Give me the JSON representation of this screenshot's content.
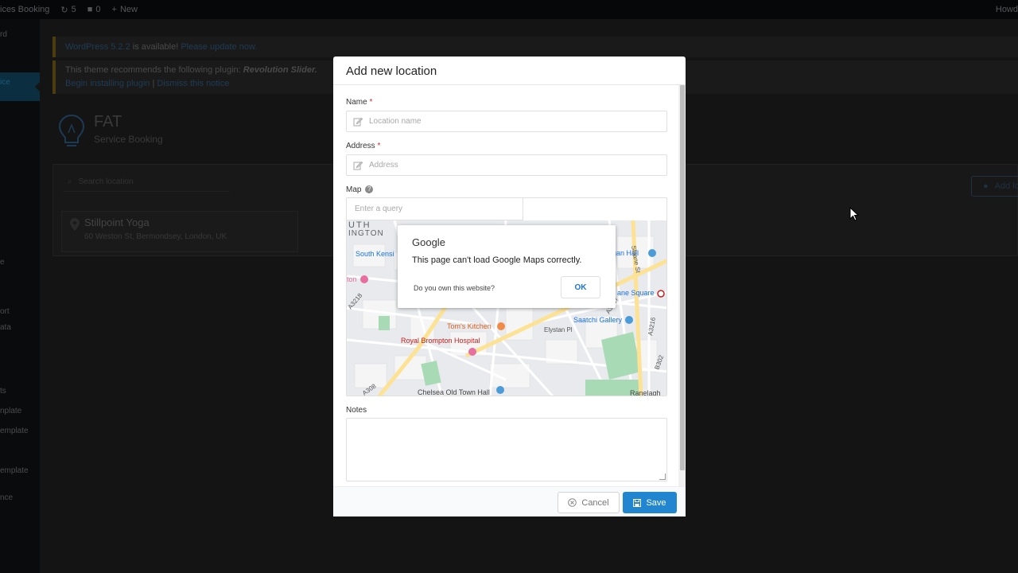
{
  "adminbar": {
    "site_name": "ices Booking",
    "updates_count": "5",
    "comments_count": "0",
    "new_label": "New",
    "howdy": "Howd"
  },
  "sidebar": {
    "items": [
      "rd",
      "ice",
      "e",
      "ort",
      "ata",
      "ts",
      "nplate",
      "emplate",
      "emplate",
      "nce"
    ]
  },
  "notices": {
    "update_text_link": "WordPress 5.2.2",
    "update_text": " is available! ",
    "update_action": "Please update now.",
    "plugin_text": "This theme recommends the following plugin: ",
    "plugin_name": "Revolution Slider.",
    "begin_install": "Begin installing plugin",
    "separator": " | ",
    "dismiss": "Dismiss this notice"
  },
  "brand": {
    "title": "FAT",
    "subtitle": "Service Booking"
  },
  "background_list": {
    "search_placeholder": "Search location",
    "location_name": "Stillpoint Yoga",
    "location_address": "60 Weston St, Bermondsey, London, UK",
    "add_button": "Add lo"
  },
  "modal": {
    "title": "Add new location",
    "name_label": "Name",
    "name_placeholder": "Location name",
    "address_label": "Address",
    "address_placeholder": "Address",
    "required_mark": "*",
    "map_label": "Map",
    "map_help": "?",
    "map_query_placeholder": "Enter a query",
    "notes_label": "Notes",
    "cancel_label": "Cancel",
    "save_label": "Save"
  },
  "map": {
    "dialog_brand": "Google",
    "dialog_message": "This page can't load Google Maps correctly.",
    "dialog_question": "Do you own this website?",
    "dialog_ok": "OK",
    "labels": {
      "uth": "UTH",
      "ington": "INGTON",
      "south_kensi": "South Kensi",
      "ton": "ton",
      "a3218": "A3218",
      "toms_kitchen": "Tom's Kitchen",
      "royal_brompton": "Royal Brompton Hospital",
      "saatchi": "Saatchi Gallery",
      "cadogan_hall": "ogan Hall",
      "sloane_square": "ane Square",
      "chelsea_old": "Chelsea Old Town Hall",
      "ranelagh": "Ranelagh",
      "a308": "A308",
      "a3217": "A3217",
      "a3216": "A3216",
      "b302": "B302",
      "elystan_pl": "Elystan Pl",
      "sloane_st": "Sloane St"
    },
    "colors": {
      "land": "#e8eaed",
      "road_major": "#fde293",
      "park": "#a8dab5",
      "poi_orange": "#f28b48",
      "poi_pink": "#e86e9f",
      "poi_blue": "#4b9bd8",
      "label_blue": "#1a73e8",
      "label_red": "#c5221f"
    }
  },
  "colors": {
    "primary": "#2185d0",
    "required": "#db2828"
  }
}
